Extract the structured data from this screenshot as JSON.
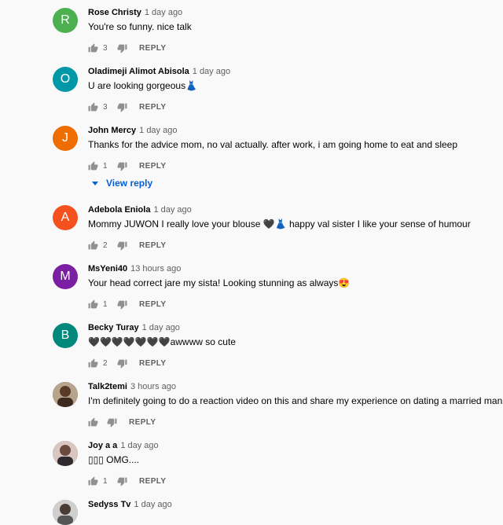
{
  "colors": {
    "avatar_r": "#4caf50",
    "avatar_o": "#0097a7",
    "avatar_j": "#ef6c00",
    "avatar_a": "#f4511e",
    "avatar_m": "#7b1fa2",
    "avatar_b": "#00897b",
    "link_blue": "#065fd4"
  },
  "comments": [
    {
      "initial": "R",
      "author": "Rose Christy",
      "time": "1 day ago",
      "text": "You're so funny. nice talk",
      "likes": "3",
      "reply": "REPLY"
    },
    {
      "initial": "O",
      "author": "Oladimeji Alimot Abisola",
      "time": "1 day ago",
      "text": "U are looking gorgeous👗",
      "likes": "3",
      "reply": "REPLY"
    },
    {
      "initial": "J",
      "author": "John Mercy",
      "time": "1 day ago",
      "text": "Thanks for the advice mom, no val actually. after work, i am going home to eat and sleep",
      "likes": "1",
      "reply": "REPLY",
      "view_reply": "View reply"
    },
    {
      "initial": "A",
      "author": "Adebola Eniola",
      "time": "1 day ago",
      "text": "Mommy JUWON I really love your blouse 🖤👗 happy val sister I like your sense of humour",
      "likes": "2",
      "reply": "REPLY"
    },
    {
      "initial": "M",
      "author": "MsYeni40",
      "time": "13 hours ago",
      "text": "Your head correct jare my sista! Looking stunning as always😍",
      "likes": "1",
      "reply": "REPLY"
    },
    {
      "initial": "B",
      "author": "Becky Turay",
      "time": "1 day ago",
      "text": "🖤🖤🖤🖤🖤🖤🖤awwww so cute",
      "likes": "2",
      "reply": "REPLY"
    },
    {
      "author": "Talk2temi",
      "time": "3 hours ago",
      "text": "I'm definitely going to do a reaction video on this and share my experience on dating a married man.",
      "likes": "",
      "reply": "REPLY"
    },
    {
      "author": "Joy a a",
      "time": "1 day ago",
      "text": "▯▯▯ OMG....",
      "likes": "1",
      "reply": "REPLY"
    },
    {
      "author": "Sedyss Tv",
      "time": "1 day ago"
    }
  ]
}
